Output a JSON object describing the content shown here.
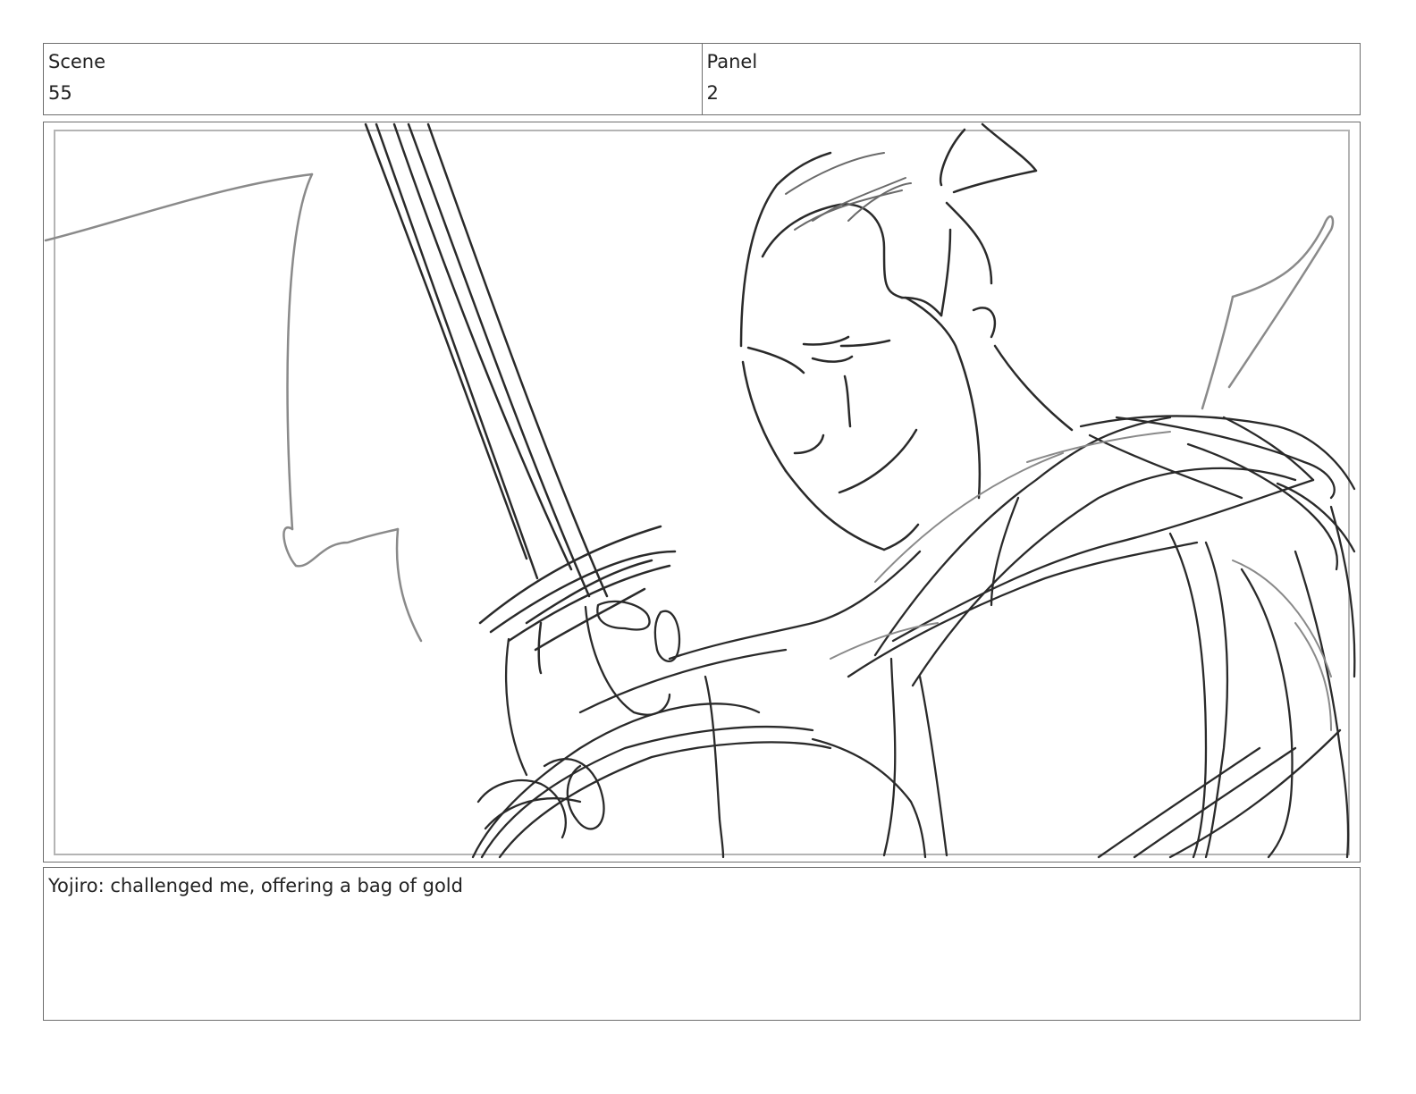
{
  "header": {
    "scene_label": "Scene",
    "scene_value": "55",
    "panel_label": "Panel",
    "panel_value": "2"
  },
  "frame": {
    "sketch_description_name": "storyboard-sketch"
  },
  "dialogue": {
    "text": "Yojiro: challenged me, offering a bag of gold"
  },
  "colors": {
    "border": "#6e6e6e",
    "inner_border": "#b4b4b4",
    "sketch_dark": "#2a2a2a",
    "sketch_light": "#8a8a8a"
  }
}
